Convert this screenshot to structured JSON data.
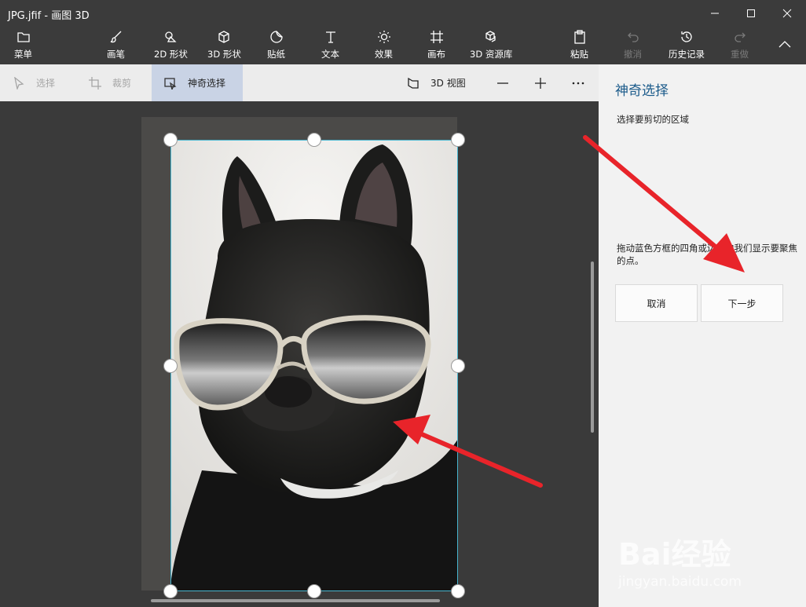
{
  "window": {
    "title": "JPG.jfif - 画图 3D"
  },
  "ribbon": {
    "menu": {
      "label": "菜单",
      "icon": "folder-icon"
    },
    "tools": [
      {
        "label": "画笔",
        "icon": "brush-icon"
      },
      {
        "label": "2D 形状",
        "icon": "shapes-2d-icon"
      },
      {
        "label": "3D 形状",
        "icon": "cube-icon"
      },
      {
        "label": "贴纸",
        "icon": "sticker-icon"
      },
      {
        "label": "文本",
        "icon": "text-icon"
      },
      {
        "label": "效果",
        "icon": "sun-icon"
      },
      {
        "label": "画布",
        "icon": "canvas-icon"
      },
      {
        "label": "3D 资源库",
        "icon": "library-icon"
      }
    ],
    "paste": {
      "label": "粘贴",
      "icon": "clipboard-icon"
    },
    "undo": {
      "label": "撤消",
      "icon": "undo-icon"
    },
    "history": {
      "label": "历史记录",
      "icon": "history-icon"
    },
    "redo": {
      "label": "重做",
      "icon": "redo-icon"
    }
  },
  "subtoolbar": {
    "select": "选择",
    "crop": "裁剪",
    "magic_select": "神奇选择",
    "view_3d": "3D 视图"
  },
  "panel": {
    "title": "神奇选择",
    "description": "选择要剪切的区域",
    "hint": "拖动蓝色方框的四角或边以向我们显示要聚焦的点。",
    "cancel_label": "取消",
    "next_label": "下一步"
  },
  "watermark": {
    "brand": "Bai经验",
    "url": "jingyan.baidu.com"
  },
  "colors": {
    "accent": "#47b5cf",
    "panel_title": "#1a5a8a",
    "arrow": "#e8242a"
  }
}
